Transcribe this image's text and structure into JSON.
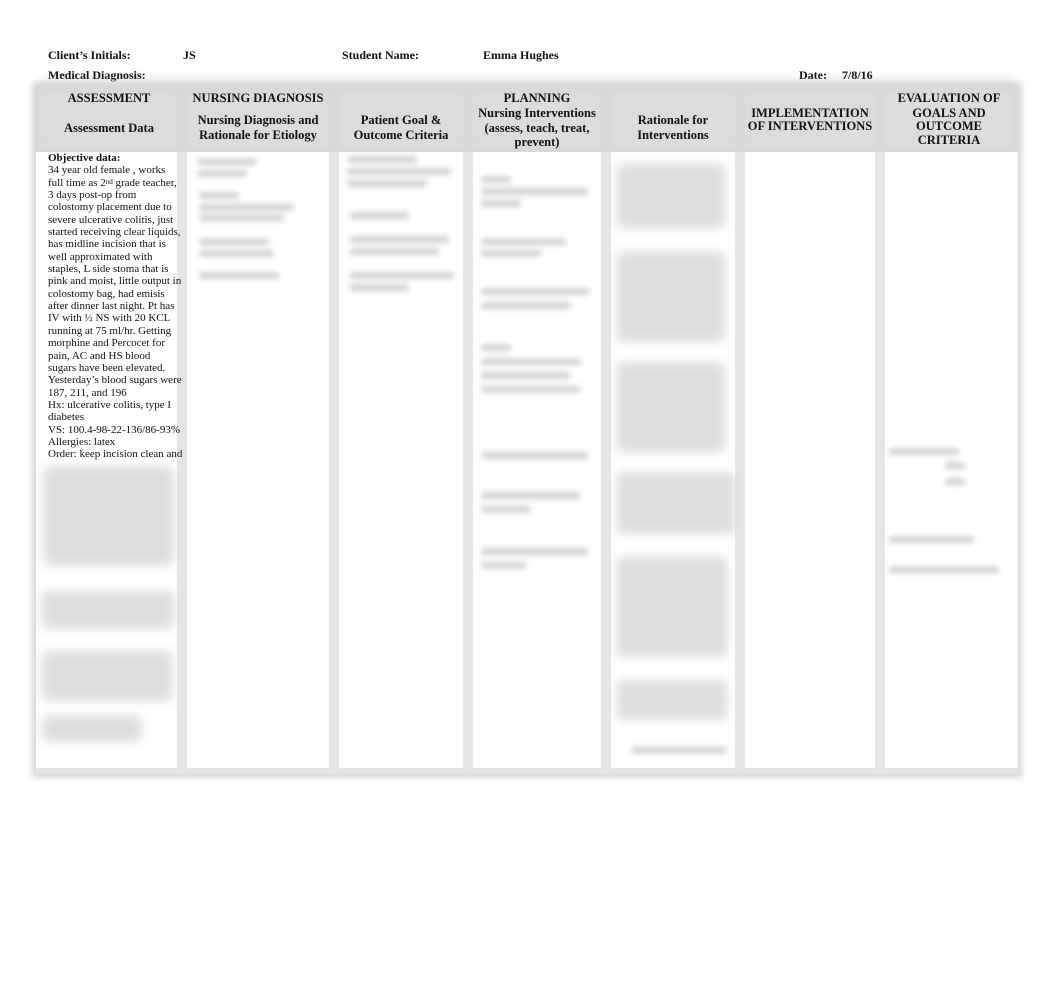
{
  "header": {
    "client_initials_label": "Client’s Initials:",
    "client_initials_value": "JS",
    "student_name_label": "Student Name:",
    "student_name_value": "Emma Hughes",
    "medical_diagnosis_label": "Medical Diagnosis:",
    "medical_diagnosis_value": "",
    "date_label": "Date:",
    "date_value": "7/8/16"
  },
  "columns": {
    "assessment": {
      "group": "ASSESSMENT",
      "title": "Assessment Data"
    },
    "nursing_diagnosis": {
      "group": "NURSING DIAGNOSIS",
      "title_line1": "Nursing Diagnosis and",
      "title_line2": "Rationale for Etiology"
    },
    "patient_goal": {
      "title_line1": "Patient Goal &",
      "title_line2": "Outcome Criteria"
    },
    "planning": {
      "group": "PLANNING",
      "title_line1": "Nursing Interventions",
      "title_line2": "(assess, teach, treat,",
      "title_line3": "prevent)"
    },
    "rationale": {
      "title_line1": "Rationale for",
      "title_line2": "Interventions"
    },
    "implementation": {
      "title_line1": "IMPLEMENTATION",
      "title_line2": "OF INTERVENTIONS"
    },
    "evaluation": {
      "title_line1": "EVALUATION OF",
      "title_line2": "GOALS AND",
      "title_line3": "OUTCOME",
      "title_line4": "CRITERIA"
    }
  },
  "assessment_data": {
    "objective_label": "Objective data:",
    "line_01": "34 year old female , works",
    "line_02_pre": "full time as 2",
    "line_02_sup": "nd",
    "line_02_post": " grade teacher,",
    "line_03": "3 days post-op from",
    "line_04": "colostomy placement due to",
    "line_05": "severe ulcerative colitis, just",
    "line_06": "started receiving clear liquids,",
    "line_07": "has midline incision that is",
    "line_08": "well approximated with",
    "line_09": "staples, L side stoma that is",
    "line_10": "pink and moist, little output in",
    "line_11": "colostomy bag, had emisis",
    "line_12": "after dinner last night.  Pt has",
    "line_13": "IV with ½ NS with 20 KCL",
    "line_14": "running at 75 ml/hr. Getting",
    "line_15": "morphine and Percocet for",
    "line_16": "pain,  AC and HS blood",
    "line_17": "sugars have been elevated.",
    "line_18": "Yesterday’s blood sugars were",
    "line_19": "187, 211, and 196",
    "line_20": "Hx: ulcerative colitis, type I",
    "line_21": "diabetes",
    "line_22": "VS: 100.4-98-22-136/86-93%",
    "line_23": "Allergies: latex",
    "line_24": "Order: keep incision clean and"
  }
}
